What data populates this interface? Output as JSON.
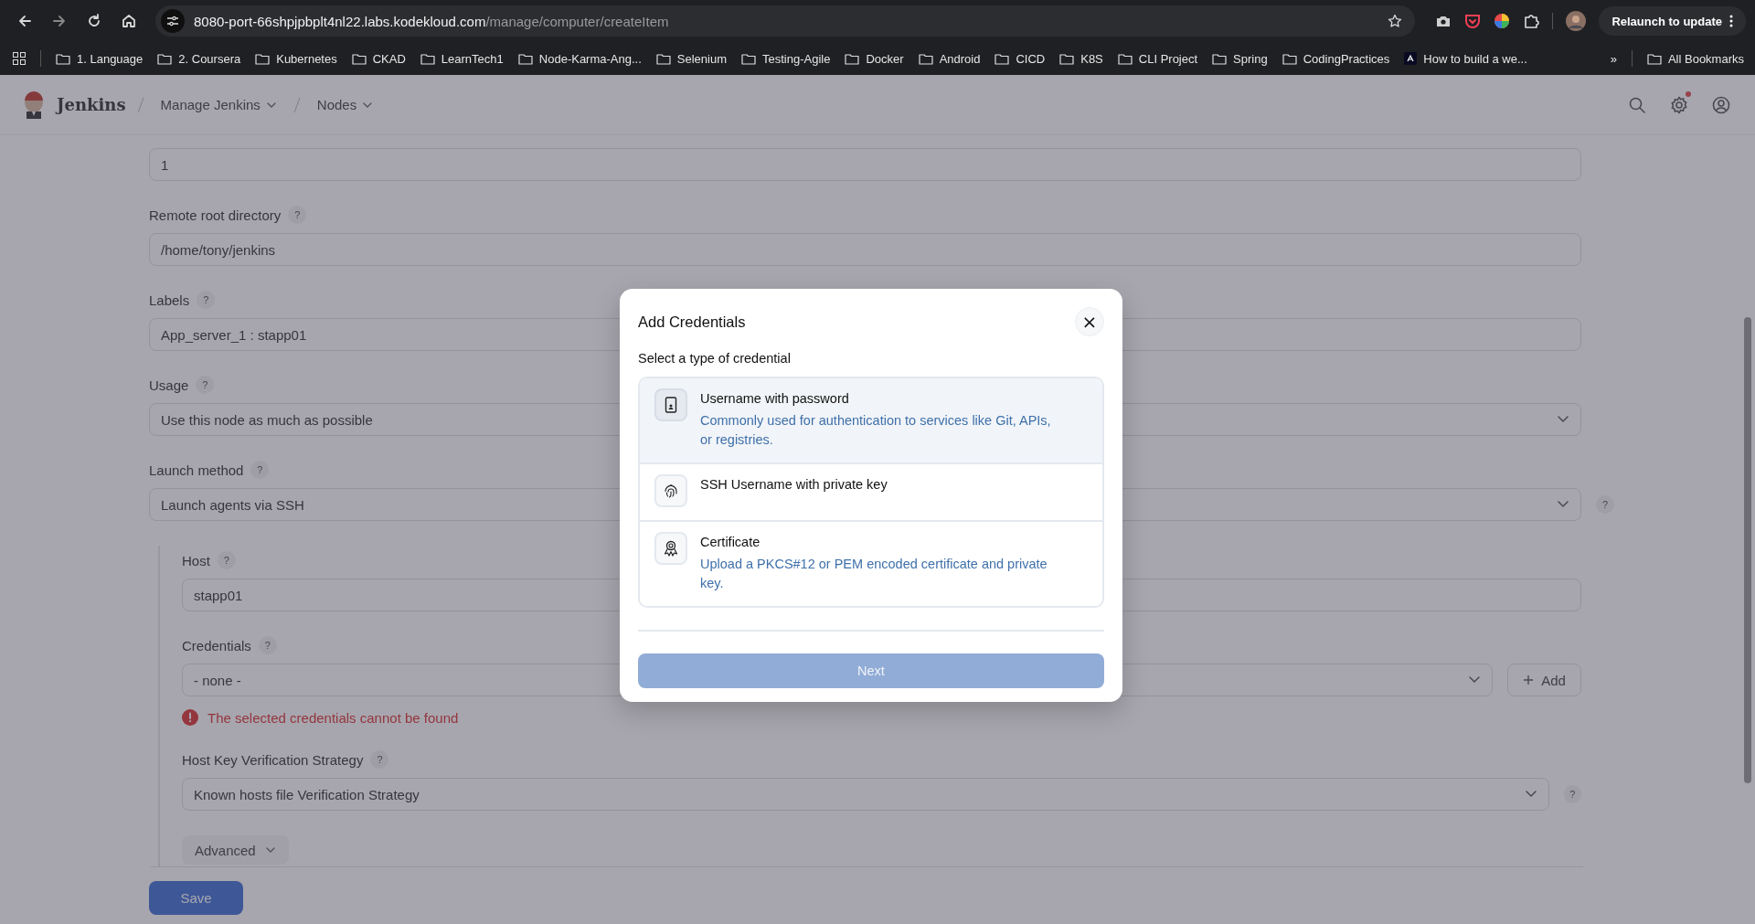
{
  "browser": {
    "url_host": "8080-port-66shpjpbplt4nl22.labs.kodekloud.com",
    "url_path": "/manage/computer/createItem",
    "relaunch": "Relaunch to update",
    "bookmarks": [
      {
        "label": "1. Language",
        "kind": "folder"
      },
      {
        "label": "2. Coursera",
        "kind": "folder"
      },
      {
        "label": "Kubernetes",
        "kind": "folder"
      },
      {
        "label": "CKAD",
        "kind": "folder"
      },
      {
        "label": "LearnTech1",
        "kind": "folder"
      },
      {
        "label": "Node-Karma-Ang...",
        "kind": "folder"
      },
      {
        "label": "Selenium",
        "kind": "folder"
      },
      {
        "label": "Testing-Agile",
        "kind": "folder"
      },
      {
        "label": "Docker",
        "kind": "folder"
      },
      {
        "label": "Android",
        "kind": "folder"
      },
      {
        "label": "CICD",
        "kind": "folder"
      },
      {
        "label": "K8S",
        "kind": "folder"
      },
      {
        "label": "CLI Project",
        "kind": "folder"
      },
      {
        "label": "Spring",
        "kind": "folder"
      },
      {
        "label": "CodingPractices",
        "kind": "folder"
      },
      {
        "label": "How to build a we...",
        "kind": "site"
      }
    ],
    "more": "»",
    "all_bookmarks": "All Bookmarks"
  },
  "header": {
    "brand": "Jenkins",
    "breadcrumbs": [
      {
        "label": "Manage Jenkins"
      },
      {
        "label": "Nodes"
      }
    ],
    "settings_alert": true
  },
  "form": {
    "fields": [
      {
        "kind": "input",
        "value": "1"
      },
      {
        "kind": "input",
        "label": "Remote root directory",
        "help": "?",
        "value": "/home/tony/jenkins"
      },
      {
        "kind": "input",
        "label": "Labels",
        "help": "?",
        "value": "App_server_1 : stapp01"
      },
      {
        "kind": "select",
        "label": "Usage",
        "help": "?",
        "value": "Use this node as much as possible"
      },
      {
        "kind": "select",
        "label": "Launch method",
        "help": "?",
        "value": "Launch agents via SSH",
        "side_help": "?"
      }
    ],
    "ssh": {
      "fields": [
        {
          "kind": "input",
          "label": "Host",
          "help": "?",
          "value": "stapp01"
        },
        {
          "kind": "select",
          "label": "Credentials",
          "help": "?",
          "value": "- none -",
          "add": "Add",
          "error": "The selected credentials cannot be found"
        },
        {
          "kind": "select",
          "label": "Host Key Verification Strategy",
          "help": "?",
          "value": "Known hosts file Verification Strategy",
          "side_help": "?"
        }
      ],
      "advanced": "Advanced"
    },
    "save": "Save"
  },
  "modal": {
    "title": "Add Credentials",
    "close": "×",
    "subtitle": "Select a type of credential",
    "options": [
      {
        "kind": "phone",
        "title": "Username with password",
        "description": "Commonly used for authentication to services like Git, APIs, or registries.",
        "selected": true
      },
      {
        "kind": "fingerprint",
        "title": "SSH Username with private key",
        "selected": false
      },
      {
        "kind": "award",
        "title": "Certificate",
        "description": "Upload a PKCS#12 or PEM encoded certificate and private key.",
        "selected": false
      }
    ],
    "next": "Next",
    "next_disabled": true
  }
}
